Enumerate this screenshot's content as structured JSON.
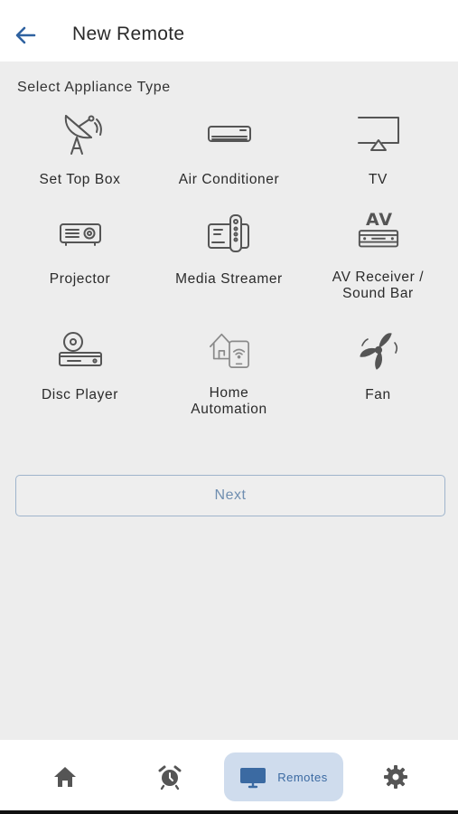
{
  "header": {
    "title": "New Remote",
    "back_icon": "arrow-left-icon"
  },
  "section": {
    "label": "Select Appliance Type"
  },
  "appliances": [
    {
      "label": "Set Top Box",
      "icon": "satellite-dish-icon"
    },
    {
      "label": "Air Conditioner",
      "icon": "air-conditioner-icon"
    },
    {
      "label": "TV",
      "icon": "tv-icon"
    },
    {
      "label": "Projector",
      "icon": "projector-icon"
    },
    {
      "label": "Media Streamer",
      "icon": "media-streamer-icon"
    },
    {
      "label": "AV Receiver / Sound Bar",
      "icon": "av-receiver-icon"
    },
    {
      "label": "Disc Player",
      "icon": "disc-player-icon"
    },
    {
      "label": "Home Automation",
      "icon": "home-automation-icon"
    },
    {
      "label": "Fan",
      "icon": "fan-icon"
    }
  ],
  "av_icon_text": "AV",
  "next_button": {
    "label": "Next"
  },
  "bottom_nav": {
    "items": [
      {
        "icon": "home-icon"
      },
      {
        "icon": "alarm-clock-icon"
      },
      {
        "icon": "monitor-icon",
        "label": "Remotes",
        "active": true
      },
      {
        "icon": "gear-icon"
      }
    ]
  },
  "colors": {
    "accent": "#3b6aa2",
    "active_bg": "#cfdced",
    "background": "#ededed",
    "icon_gray": "#555555"
  }
}
